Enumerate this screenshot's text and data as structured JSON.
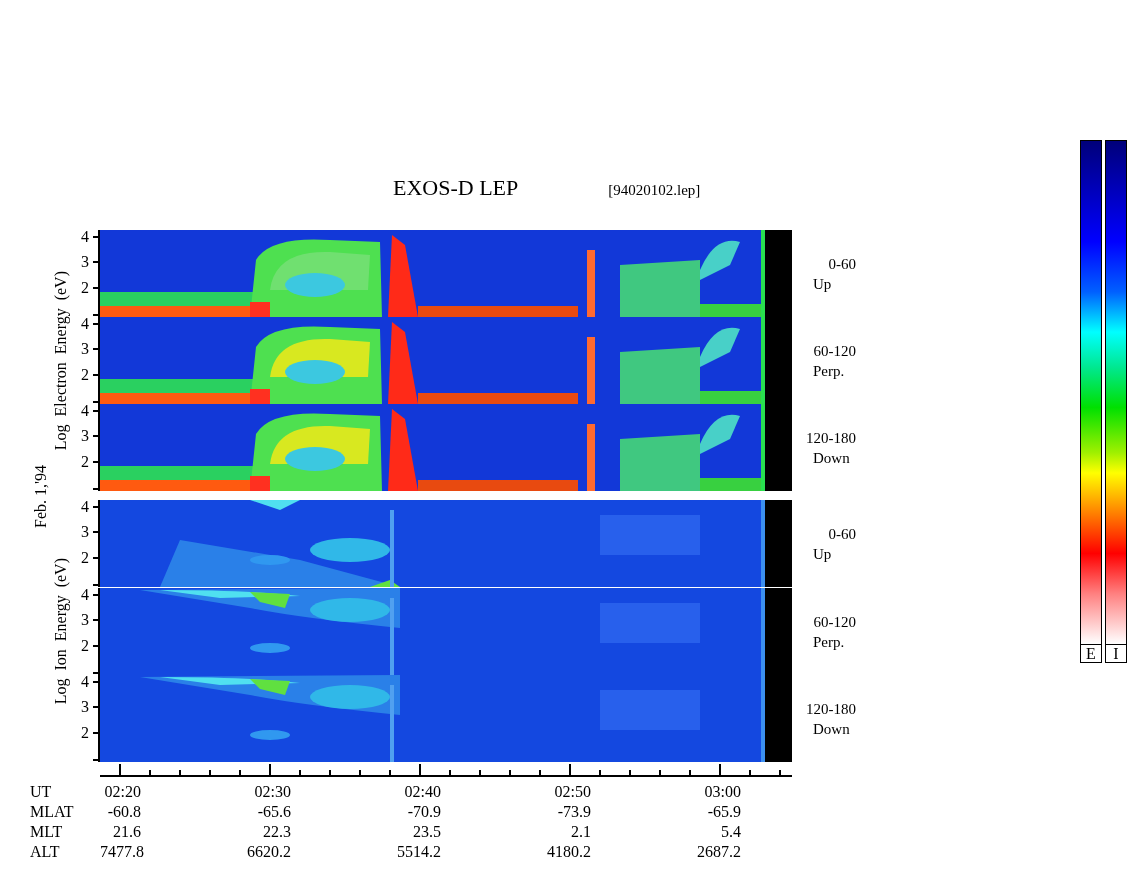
{
  "chart": {
    "title": "EXOS-D LEP",
    "file": "[94020102.lep]"
  },
  "date_label": "Feb. 1,'94",
  "groups": [
    {
      "kind": "electron",
      "axis_label": "Log  Electron  Energy  (eV)",
      "panels": [
        {
          "yticks": [
            "4",
            "3",
            "2"
          ],
          "pitch": "0-60",
          "direction": "Up"
        },
        {
          "yticks": [
            "4",
            "3",
            "2"
          ],
          "pitch": "60-120",
          "direction": "Perp."
        },
        {
          "yticks": [
            "4",
            "3",
            "2"
          ],
          "pitch": "120-180",
          "direction": "Down"
        }
      ]
    },
    {
      "kind": "ion",
      "axis_label": "Log  Ion  Energy  (eV)",
      "panels": [
        {
          "yticks": [
            "4",
            "3",
            "2"
          ],
          "pitch": "0-60",
          "direction": "Up"
        },
        {
          "yticks": [
            "4",
            "3",
            "2"
          ],
          "pitch": "60-120",
          "direction": "Perp."
        },
        {
          "yticks": [
            "4",
            "3",
            "2"
          ],
          "pitch": "120-180",
          "direction": "Down"
        }
      ]
    }
  ],
  "time_axis": {
    "rows": [
      {
        "label": "UT",
        "values": [
          "02:20",
          "02:30",
          "02:40",
          "02:50",
          "03:00"
        ]
      },
      {
        "label": "MLAT",
        "values": [
          "-60.8",
          "-65.6",
          "-70.9",
          "-73.9",
          "-65.9"
        ]
      },
      {
        "label": "MLT",
        "values": [
          "21.6",
          "22.3",
          "23.5",
          "2.1",
          "5.4"
        ]
      },
      {
        "label": "ALT",
        "values": [
          "7477.8",
          "6620.2",
          "5514.2",
          "4180.2",
          "2687.2"
        ]
      }
    ]
  },
  "color_bars": [
    {
      "label": "E"
    },
    {
      "label": "I"
    }
  ]
}
